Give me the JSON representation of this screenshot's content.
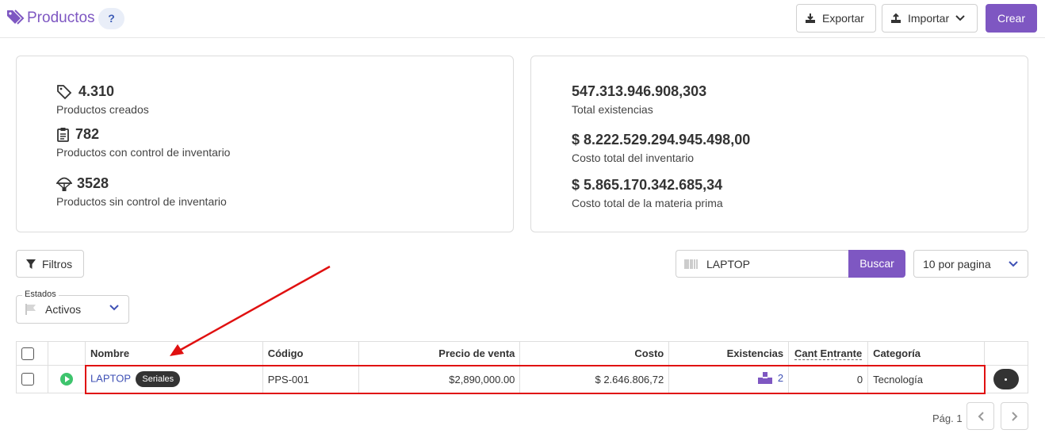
{
  "header": {
    "title": "Productos",
    "help_label": "?",
    "export_label": "Exportar",
    "import_label": "Importar",
    "create_label": "Crear"
  },
  "colors": {
    "brand": "#7e57c2",
    "link": "#3f51b5",
    "active": "#3ec46d",
    "annotation": "#e01010"
  },
  "stats_left": [
    {
      "icon": "tag-icon",
      "value": "4.310",
      "label": "Productos creados"
    },
    {
      "icon": "clipboard-icon",
      "value": "782",
      "label": "Productos con control de inventario"
    },
    {
      "icon": "parachute-icon",
      "value": "3528",
      "label": "Productos sin control de inventario"
    }
  ],
  "stats_right": [
    {
      "value": "547.313.946.908,303",
      "label": "Total existencias"
    },
    {
      "value": "$ 8.222.529.294.945.498,00",
      "label": "Costo total del inventario"
    },
    {
      "value": "$ 5.865.170.342.685,34",
      "label": "Costo total de la materia prima"
    }
  ],
  "filters": {
    "filters_label": "Filtros",
    "search_value": "LAPTOP",
    "search_button": "Buscar",
    "per_page": "10 por pagina",
    "estados_label": "Estados",
    "estados_value": "Activos"
  },
  "table": {
    "columns": [
      "Nombre",
      "Código",
      "Precio de venta",
      "Costo",
      "Existencias",
      "Cant Entrante",
      "Categoría"
    ],
    "rows": [
      {
        "name": "LAPTOP",
        "badge": "Seriales",
        "code": "PPS-001",
        "price": "$2,890,000.00",
        "cost": "$ 2.646.806,72",
        "stock": "2",
        "incoming": "0",
        "category": "Tecnología"
      }
    ]
  },
  "pagination": {
    "label": "Pág. 1"
  }
}
